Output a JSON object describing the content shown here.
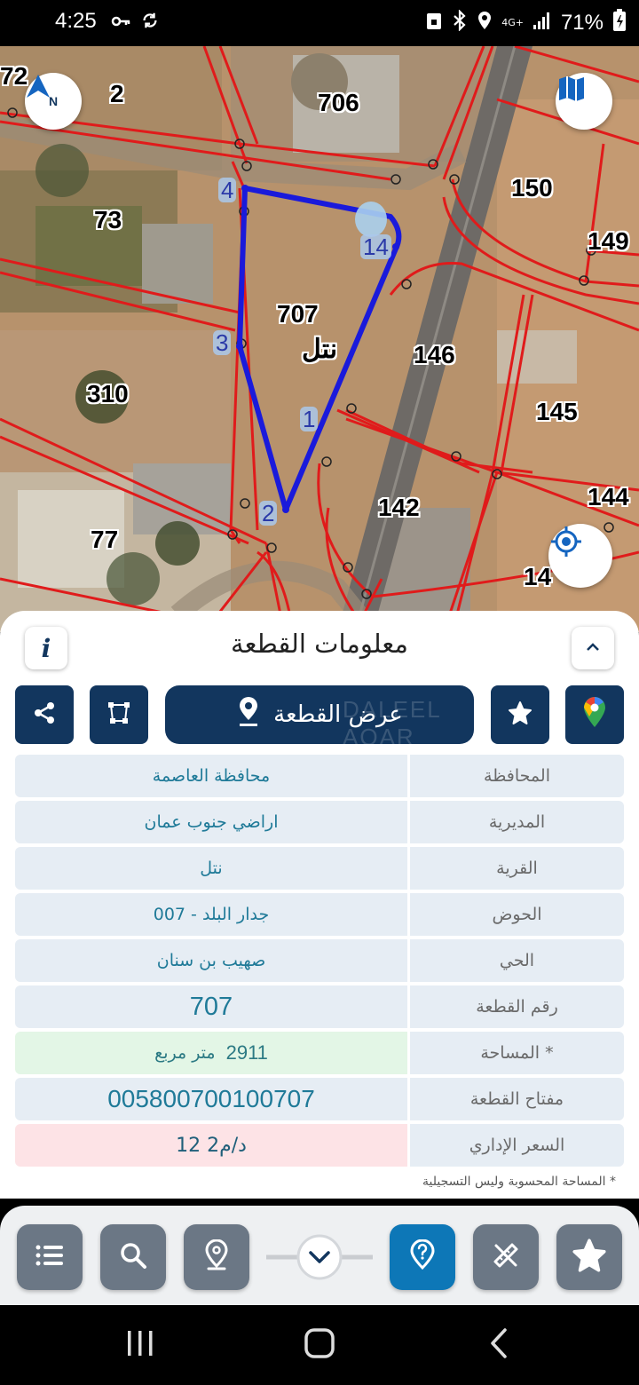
{
  "status_bar": {
    "time": "4:25",
    "network": "4G+",
    "battery": "71%"
  },
  "map": {
    "parcel_labels": [
      "72",
      "2",
      "706",
      "150",
      "149",
      "73",
      "707",
      "146",
      "310",
      "145",
      "77",
      "142",
      "144",
      "14"
    ],
    "village_label": "نتل",
    "vertex_labels": [
      "4",
      "14",
      "3",
      "1",
      "2"
    ],
    "compass_letter": "N"
  },
  "panel": {
    "title": "معلومات القطعة",
    "info_label": "i",
    "show_parcel_label": "عرض القطعة",
    "watermark": "DALEEL AQAR",
    "rows": [
      {
        "label": "المحافظة",
        "value": "محافظة العاصمة"
      },
      {
        "label": "المديرية",
        "value": "اراضي جنوب عمان"
      },
      {
        "label": "القرية",
        "value": "نتل"
      },
      {
        "label": "الحوض",
        "value": "جدار البلد - 007"
      },
      {
        "label": "الحي",
        "value": "صهيب بن سنان"
      },
      {
        "label": "رقم القطعة",
        "value": "707"
      },
      {
        "label": "المساحة *",
        "value": "2911",
        "unit": "متر مربع"
      },
      {
        "label": "مفتاح القطعة",
        "value": "005800700100707"
      },
      {
        "label": "السعر الإداري",
        "value": "12 د/م2"
      }
    ],
    "footnote": "* المساحة المحسوبة وليس التسجيلية"
  },
  "colors": {
    "navy": "#12365e",
    "accent_blue": "#0d77b7",
    "parcel_outline": "#1a1adb",
    "boundary_red": "#e01b1b"
  }
}
